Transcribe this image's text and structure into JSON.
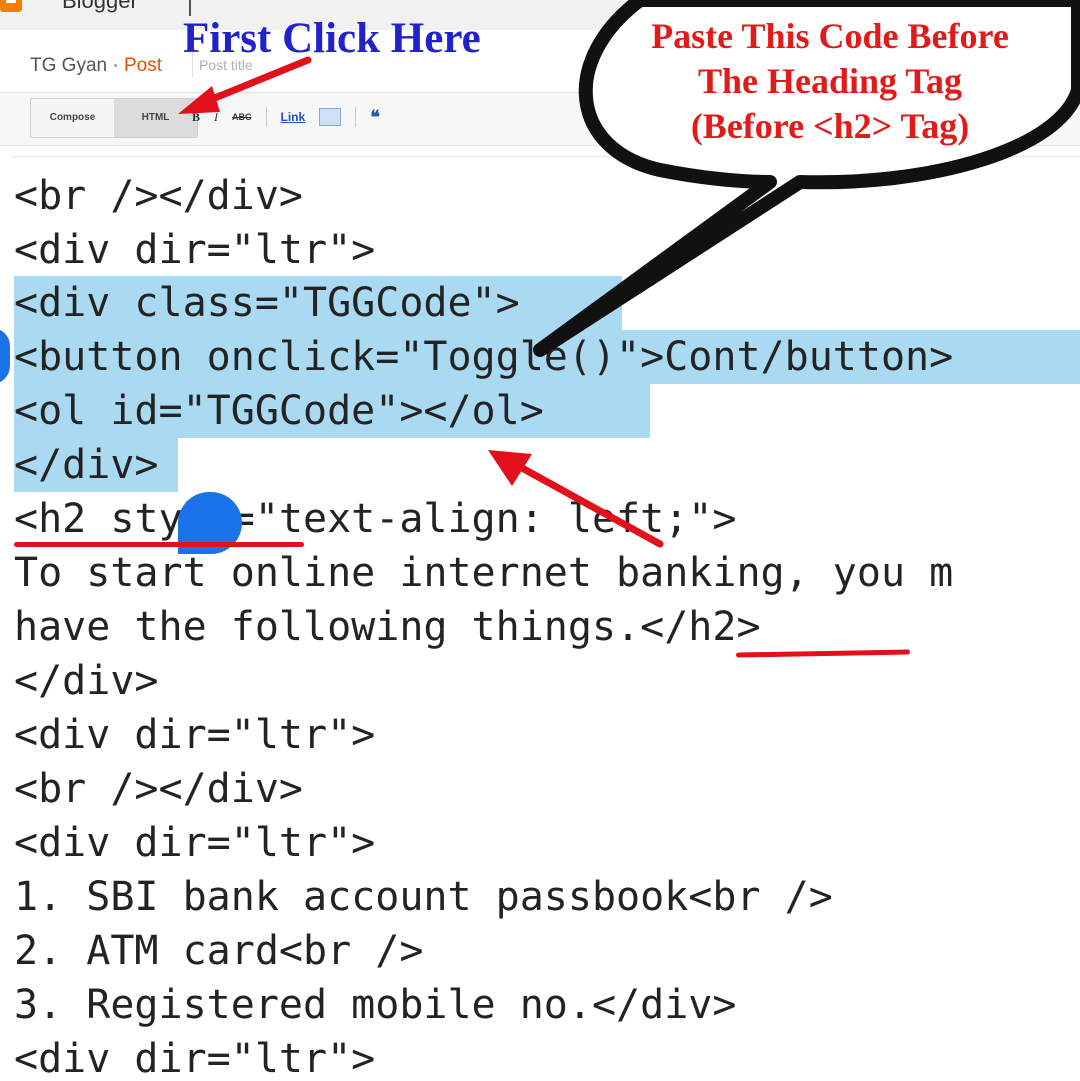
{
  "app": {
    "name": "Blogger"
  },
  "header": {
    "blog_name": "TG Gyan · ",
    "post_word": "Post",
    "post_title_placeholder": "Post title"
  },
  "toolbar": {
    "compose_label": "Compose",
    "html_label": "HTML",
    "bold": "B",
    "italic": "I",
    "strikethrough": "ABC",
    "link": "Link",
    "quote": "❝"
  },
  "editor": {
    "lines": [
      "<br /></div>",
      "<div dir=\"ltr\">",
      "<div class=\"TGGCode\">",
      "<button onclick=\"Toggle()\">Cont/button>",
      "<ol id=\"TGGCode\"></ol>",
      "</div>",
      "<h2 style=\"text-align: left;\">",
      "To start online internet banking, you m",
      "have the following things.</h2>",
      "</div>",
      "<div dir=\"ltr\">",
      "<br /></div>",
      "<div dir=\"ltr\">",
      "1. SBI bank account passbook<br />",
      "2. ATM card<br />",
      "3. Registered mobile no.</div>",
      "<div dir=\"ltr\">"
    ]
  },
  "annotations": {
    "first_click": "First Click Here",
    "bubble_line1": "Paste This Code Before",
    "bubble_line2": "The Heading Tag",
    "bubble_line3": "(Before <h2> Tag)"
  },
  "colors": {
    "selection": "#aad9f2",
    "arrow_red": "#e2101a",
    "annotation_blue": "#2222cc",
    "annotation_red": "#e11a1a",
    "handle_blue": "#1a73e8",
    "post_orange": "#e65100"
  }
}
